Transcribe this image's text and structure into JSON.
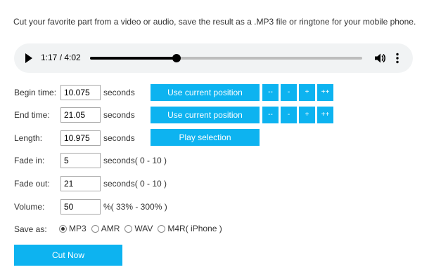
{
  "intro_text": "Cut your favorite part from a video or audio, save the result as a .MP3 file or ringtone for your mobile phone.",
  "player": {
    "time_display": "1:17 / 4:02",
    "progress": 0.317,
    "play_icon": "play-icon",
    "volume_icon": "volume-icon",
    "more_icon": "more-vert-icon"
  },
  "begin": {
    "label": "Begin time:",
    "value": "10.075",
    "unit": "seconds",
    "use_current_label": "Use current position",
    "adjust_buttons": [
      "--",
      "-",
      "+",
      "++"
    ]
  },
  "end": {
    "label": "End time:",
    "value": "21.05",
    "unit": "seconds",
    "use_current_label": "Use current position",
    "adjust_buttons": [
      "--",
      "-",
      "+",
      "++"
    ]
  },
  "length": {
    "label": "Length:",
    "value": "10.975",
    "unit": "seconds",
    "play_selection_label": "Play selection"
  },
  "fade_in": {
    "label": "Fade in:",
    "value": "5",
    "unit": "seconds( 0 - 10 )"
  },
  "fade_out": {
    "label": "Fade out:",
    "value": "21",
    "unit": "seconds( 0 - 10 )"
  },
  "volume": {
    "label": "Volume:",
    "value": "50",
    "unit": "%( 33% - 300% )"
  },
  "save_as": {
    "label": "Save as:",
    "options": [
      "MP3",
      "AMR",
      "WAV",
      "M4R( iPhone )"
    ],
    "selected": "MP3"
  },
  "cut_now_label": "Cut Now",
  "colors": {
    "accent": "#0db3f0",
    "player_bg": "#f1f3f4"
  }
}
